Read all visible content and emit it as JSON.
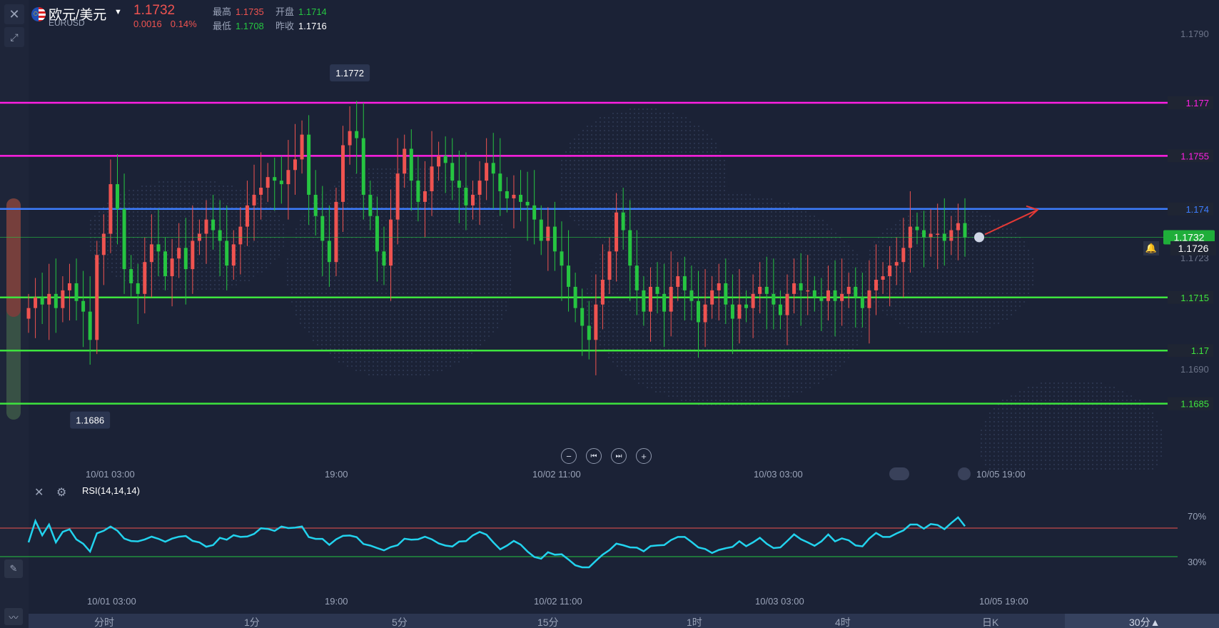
{
  "header": {
    "title": "欧元/美元",
    "symbol": "EURUSD",
    "price": "1.1732",
    "change": "0.0016",
    "change_pct": "0.14%",
    "high_label": "最高",
    "high": "1.1735",
    "open_label": "开盘",
    "open": "1.1714",
    "low_label": "最低",
    "low": "1.1708",
    "prev_close_label": "昨收",
    "prev_close": "1.1716"
  },
  "colors": {
    "background": "#1b2236",
    "up": "#ef5350",
    "down": "#26c541",
    "magenta": "#ff1fe3",
    "blue": "#3d7dff",
    "green_line": "#3ee43e",
    "rsi": "#22d3ee"
  },
  "icons": {
    "close": "close-icon",
    "collapse": "collapse-icon",
    "flag": "eu-us-flag-icon",
    "dropdown": "caret-down-icon",
    "alarm": "bell-icon",
    "draw": "pen-icon",
    "indicator": "indicator-icon"
  },
  "price_axis": {
    "top_label": "1.1790",
    "mid_label": "1.1723",
    "low_label": "1.1690",
    "last_price": "1.1732",
    "secondary_price": "1.1726"
  },
  "controls": {
    "zoom_out": "−",
    "prev": "⏮",
    "next": "⏭",
    "zoom_in": "+"
  },
  "x_ticks": [
    "10/01 03:00",
    "19:00",
    "10/02 11:00",
    "10/03 03:00",
    "10/05 19:00"
  ],
  "rsi": {
    "label": "RSI(14,14,14)",
    "upper_label": "70%",
    "lower_label": "30%"
  },
  "timeframes": [
    "分时",
    "1分",
    "5分",
    "15分",
    "1时",
    "4时",
    "日K",
    "30分▲"
  ],
  "chart_data": {
    "type": "candlestick",
    "title": "",
    "ylim": [
      1.167,
      1.1795
    ],
    "high_marker": "1.1772",
    "low_marker": "1.1686",
    "hlines": [
      {
        "value": 1.177,
        "label": "1.177",
        "color": "#ff1fe3"
      },
      {
        "value": 1.1755,
        "label": "1.1755",
        "color": "#ff1fe3"
      },
      {
        "value": 1.174,
        "label": "1.174",
        "color": "#3d7dff"
      },
      {
        "value": 1.1715,
        "label": "1.1715",
        "color": "#3ee43e"
      },
      {
        "value": 1.17,
        "label": "1.17",
        "color": "#3ee43e"
      },
      {
        "value": 1.1685,
        "label": "1.1685",
        "color": "#3ee43e"
      }
    ],
    "close": [
      1.1712,
      1.1715,
      1.1713,
      1.1716,
      1.1712,
      1.1717,
      1.1719,
      1.1714,
      1.1711,
      1.1703,
      1.1727,
      1.1733,
      1.1747,
      1.174,
      1.1723,
      1.1719,
      1.1716,
      1.1725,
      1.173,
      1.1728,
      1.1721,
      1.1726,
      1.1729,
      1.1723,
      1.1731,
      1.1733,
      1.1737,
      1.1734,
      1.1731,
      1.1724,
      1.173,
      1.1735,
      1.1741,
      1.1744,
      1.1746,
      1.1749,
      1.1748,
      1.1747,
      1.1751,
      1.1754,
      1.1761,
      1.1744,
      1.1738,
      1.1731,
      1.1725,
      1.1742,
      1.1758,
      1.1762,
      1.176,
      1.1744,
      1.1738,
      1.1728,
      1.1724,
      1.1737,
      1.175,
      1.1757,
      1.1748,
      1.1742,
      1.1745,
      1.1752,
      1.1755,
      1.1753,
      1.1748,
      1.1746,
      1.1741,
      1.1744,
      1.1748,
      1.1753,
      1.175,
      1.1745,
      1.1743,
      1.1744,
      1.1742,
      1.1741,
      1.1737,
      1.1731,
      1.1735,
      1.1728,
      1.1724,
      1.1718,
      1.1712,
      1.1707,
      1.1703,
      1.1713,
      1.172,
      1.1728,
      1.1739,
      1.1734,
      1.1724,
      1.1717,
      1.1711,
      1.1718,
      1.1716,
      1.1711,
      1.1718,
      1.1721,
      1.1717,
      1.1714,
      1.1708,
      1.1713,
      1.1717,
      1.1719,
      1.1713,
      1.1709,
      1.1713,
      1.1712,
      1.1716,
      1.1718,
      1.1716,
      1.1713,
      1.171,
      1.1716,
      1.1719,
      1.1717,
      1.1717,
      1.1715,
      1.1714,
      1.1717,
      1.1714,
      1.1716,
      1.1718,
      1.1715,
      1.1712,
      1.1717,
      1.172,
      1.1721,
      1.1724,
      1.1725,
      1.1729,
      1.1735,
      1.1734,
      1.1732,
      1.1733,
      1.1733,
      1.1731,
      1.1734,
      1.1736,
      1.1732
    ]
  }
}
